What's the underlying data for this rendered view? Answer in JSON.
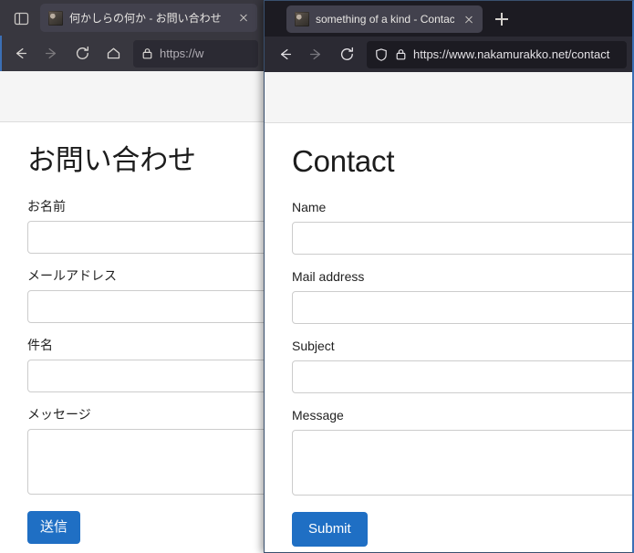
{
  "left_window": {
    "tab": {
      "title": "何かしらの何か - お問い合わせ",
      "favicon_name": "site-favicon-photo",
      "close_label": "×"
    },
    "toolbar": {
      "back_label": "Back",
      "forward_label": "Forward",
      "reload_label": "Reload",
      "home_label": "Home",
      "url": "https://w",
      "lock_label": "Secure connection"
    },
    "page": {
      "title": "お問い合わせ",
      "fields": [
        {
          "label": "お名前",
          "value": "",
          "type": "text"
        },
        {
          "label": "メールアドレス",
          "value": "",
          "type": "text"
        },
        {
          "label": "件名",
          "value": "",
          "type": "text"
        },
        {
          "label": "メッセージ",
          "value": "",
          "type": "textarea"
        }
      ],
      "submit_label": "送信"
    }
  },
  "right_window": {
    "tab": {
      "title": "something of a kind - Contact",
      "favicon_name": "site-favicon-photo",
      "close_label": "×",
      "new_tab_label": "+"
    },
    "toolbar": {
      "back_label": "Back",
      "forward_label": "Forward",
      "reload_label": "Reload",
      "url": "https://www.nakamurakko.net/contact",
      "shield_label": "Tracking protection",
      "lock_label": "Secure connection"
    },
    "page": {
      "title": "Contact",
      "fields": [
        {
          "label": "Name",
          "value": "",
          "type": "text"
        },
        {
          "label": "Mail address",
          "value": "",
          "type": "text"
        },
        {
          "label": "Subject",
          "value": "",
          "type": "text"
        },
        {
          "label": "Message",
          "value": "",
          "type": "textarea"
        }
      ],
      "submit_label": "Submit"
    }
  },
  "colors": {
    "accent_blue": "#1f6fc4",
    "window_border_active": "#3b6fb5",
    "chrome_dark": "#2b2a33",
    "tabstrip_dark": "#1c1b22",
    "tab_active": "#42414d",
    "site_header_bg": "#f5f5f5",
    "input_border": "#cccccc"
  }
}
